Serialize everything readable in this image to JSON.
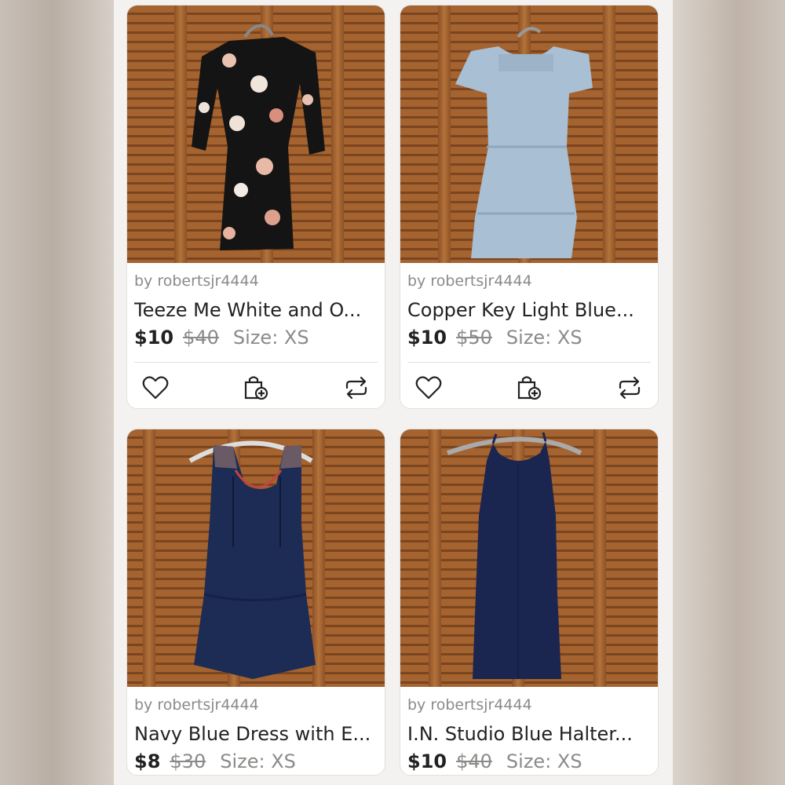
{
  "colors": {
    "card_bg": "#ffffff",
    "screen_bg": "#f4f2f1",
    "text_primary": "#222222",
    "text_muted": "#8c8a88",
    "wood": "#a4632f"
  },
  "listings": [
    {
      "seller_prefix": "by",
      "seller": "robertsjr4444",
      "title": "Teeze Me White and O...",
      "price": "$10",
      "original_price": "$40",
      "size": "Size: XS",
      "image": "black-floral-dress-photo",
      "actions": [
        "heart-icon",
        "bundle-add-icon",
        "share-icon"
      ]
    },
    {
      "seller_prefix": "by",
      "seller": "robertsjr4444",
      "title": "Copper Key Light Blue...",
      "price": "$10",
      "original_price": "$50",
      "size": "Size: XS",
      "image": "light-blue-dress-photo",
      "actions": [
        "heart-icon",
        "bundle-add-icon",
        "share-icon"
      ]
    },
    {
      "seller_prefix": "by",
      "seller": "robertsjr4444",
      "title": "Navy Blue Dress with E...",
      "price": "$8",
      "original_price": "$30",
      "size": "Size: XS",
      "image": "navy-embroidered-dress-photo"
    },
    {
      "seller_prefix": "by",
      "seller": "robertsjr4444",
      "title": "I.N. Studio Blue Halter...",
      "price": "$10",
      "original_price": "$40",
      "size": "Size: XS",
      "image": "navy-halter-dress-photo"
    }
  ]
}
